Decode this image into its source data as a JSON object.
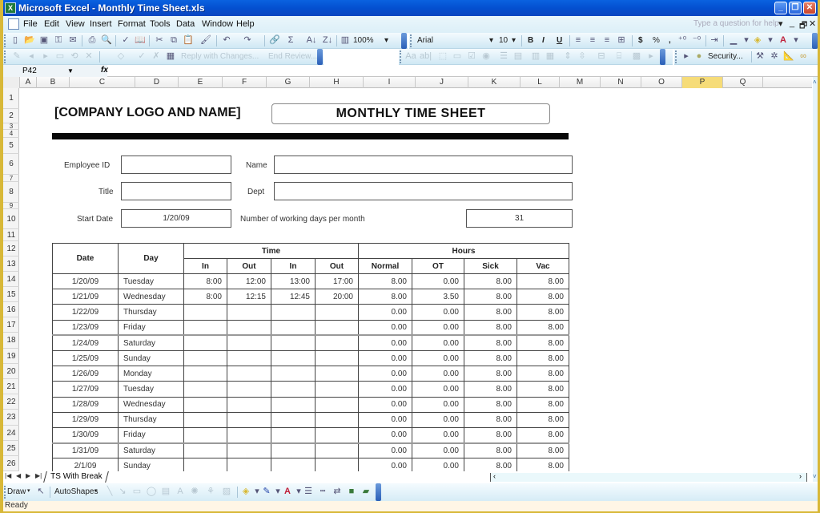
{
  "window": {
    "title": "Microsoft Excel - Monthly Time Sheet.xls",
    "app_icon": "X",
    "controls": [
      "_",
      "❐",
      "✕"
    ]
  },
  "menubar": {
    "items": [
      "File",
      "Edit",
      "View",
      "Insert",
      "Format",
      "Tools",
      "Data",
      "Window",
      "Help"
    ],
    "help_placeholder": "Type a question for help",
    "mdi_controls": [
      "▾",
      "_",
      "🗗",
      "✕"
    ]
  },
  "standard_toolbar": {
    "zoom": "100%",
    "font": "Arial",
    "font_size": "10",
    "bold": "B",
    "italic": "I",
    "underline": "U",
    "currency": "$",
    "percent": "%",
    "comma": ","
  },
  "reviewing_toolbar": {
    "reply_label": "Reply with Changes...",
    "end_review_label": "End Review...",
    "security_label": "Security..."
  },
  "formula_bar": {
    "cell_ref": "P42",
    "fx": "fx",
    "value": ""
  },
  "columns": [
    "A",
    "B",
    "C",
    "D",
    "E",
    "F",
    "G",
    "H",
    "I",
    "J",
    "K",
    "L",
    "M",
    "N",
    "O",
    "P",
    "Q"
  ],
  "selected_column": "P",
  "rows": [
    "1",
    "2",
    "3",
    "4",
    "5",
    "6",
    "7",
    "8",
    "9",
    "10",
    "11",
    "12",
    "13",
    "14",
    "15",
    "16",
    "17",
    "18",
    "19",
    "20",
    "21",
    "22",
    "23",
    "24",
    "25",
    "26"
  ],
  "sheet": {
    "company": "[COMPANY LOGO AND NAME]",
    "title": "MONTHLY TIME SHEET",
    "form": {
      "employee_id_label": "Employee ID",
      "employee_id": "",
      "name_label": "Name",
      "name": "",
      "title_label": "Title",
      "title": "",
      "dept_label": "Dept",
      "dept": "",
      "start_date_label": "Start Date",
      "start_date": "1/20/09",
      "working_days_label": "Number of working days per month",
      "working_days": "31"
    },
    "table": {
      "group_headers": {
        "date": "Date",
        "day": "Day",
        "time": "Time",
        "hours": "Hours"
      },
      "sub_headers": [
        "In",
        "Out",
        "In",
        "Out",
        "Normal",
        "OT",
        "Sick",
        "Vac"
      ],
      "rows": [
        {
          "date": "1/20/09",
          "day": "Tuesday",
          "in1": "8:00",
          "out1": "12:00",
          "in2": "13:00",
          "out2": "17:00",
          "normal": "8.00",
          "ot": "0.00",
          "sick": "8.00",
          "vac": "8.00"
        },
        {
          "date": "1/21/09",
          "day": "Wednesday",
          "in1": "8:00",
          "out1": "12:15",
          "in2": "12:45",
          "out2": "20:00",
          "normal": "8.00",
          "ot": "3.50",
          "sick": "8.00",
          "vac": "8.00"
        },
        {
          "date": "1/22/09",
          "day": "Thursday",
          "in1": "",
          "out1": "",
          "in2": "",
          "out2": "",
          "normal": "0.00",
          "ot": "0.00",
          "sick": "8.00",
          "vac": "8.00"
        },
        {
          "date": "1/23/09",
          "day": "Friday",
          "in1": "",
          "out1": "",
          "in2": "",
          "out2": "",
          "normal": "0.00",
          "ot": "0.00",
          "sick": "8.00",
          "vac": "8.00"
        },
        {
          "date": "1/24/09",
          "day": "Saturday",
          "in1": "",
          "out1": "",
          "in2": "",
          "out2": "",
          "normal": "0.00",
          "ot": "0.00",
          "sick": "8.00",
          "vac": "8.00"
        },
        {
          "date": "1/25/09",
          "day": "Sunday",
          "in1": "",
          "out1": "",
          "in2": "",
          "out2": "",
          "normal": "0.00",
          "ot": "0.00",
          "sick": "8.00",
          "vac": "8.00"
        },
        {
          "date": "1/26/09",
          "day": "Monday",
          "in1": "",
          "out1": "",
          "in2": "",
          "out2": "",
          "normal": "0.00",
          "ot": "0.00",
          "sick": "8.00",
          "vac": "8.00"
        },
        {
          "date": "1/27/09",
          "day": "Tuesday",
          "in1": "",
          "out1": "",
          "in2": "",
          "out2": "",
          "normal": "0.00",
          "ot": "0.00",
          "sick": "8.00",
          "vac": "8.00"
        },
        {
          "date": "1/28/09",
          "day": "Wednesday",
          "in1": "",
          "out1": "",
          "in2": "",
          "out2": "",
          "normal": "0.00",
          "ot": "0.00",
          "sick": "8.00",
          "vac": "8.00"
        },
        {
          "date": "1/29/09",
          "day": "Thursday",
          "in1": "",
          "out1": "",
          "in2": "",
          "out2": "",
          "normal": "0.00",
          "ot": "0.00",
          "sick": "8.00",
          "vac": "8.00"
        },
        {
          "date": "1/30/09",
          "day": "Friday",
          "in1": "",
          "out1": "",
          "in2": "",
          "out2": "",
          "normal": "0.00",
          "ot": "0.00",
          "sick": "8.00",
          "vac": "8.00"
        },
        {
          "date": "1/31/09",
          "day": "Saturday",
          "in1": "",
          "out1": "",
          "in2": "",
          "out2": "",
          "normal": "0.00",
          "ot": "0.00",
          "sick": "8.00",
          "vac": "8.00"
        },
        {
          "date": "2/1/09",
          "day": "Sunday",
          "in1": "",
          "out1": "",
          "in2": "",
          "out2": "",
          "normal": "0.00",
          "ot": "0.00",
          "sick": "8.00",
          "vac": "8.00"
        }
      ]
    }
  },
  "sheet_tabs": {
    "active": "TS With Break"
  },
  "draw_toolbar": {
    "draw_label": "Draw",
    "autoshapes_label": "AutoShapes"
  },
  "status": "Ready"
}
